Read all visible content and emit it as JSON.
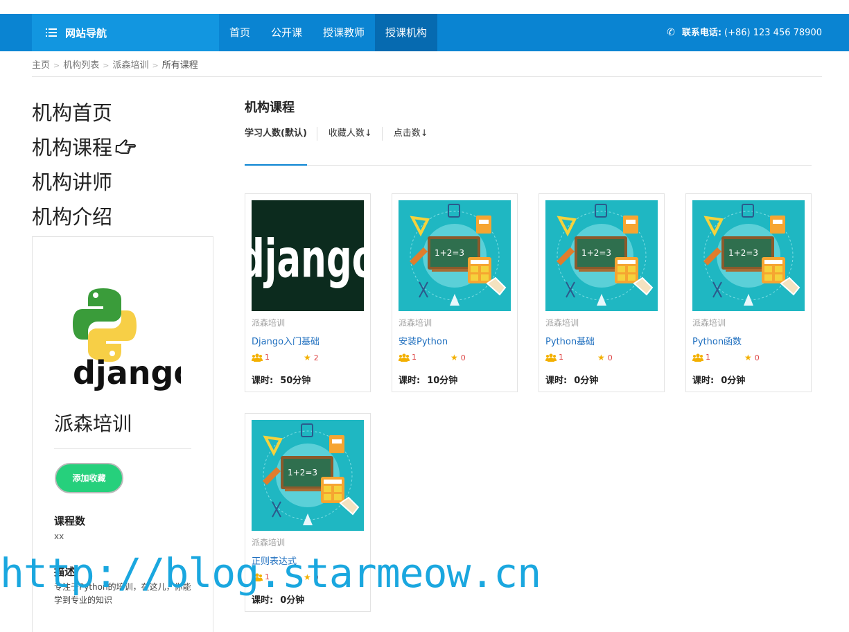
{
  "nav": {
    "brand": "网站导航",
    "links": [
      "首页",
      "公开课",
      "授课教师",
      "授课机构"
    ],
    "active_index": 3,
    "phone_label": "联系电话:",
    "phone_value": "(+86) 123 456 78900"
  },
  "breadcrumb": [
    "主页",
    "机构列表",
    "派森培训",
    "所有课程"
  ],
  "left_menu": [
    "机构首页",
    "机构课程",
    "机构讲师",
    "机构介绍"
  ],
  "active_menu_index": 1,
  "org": {
    "name": "派森培训",
    "fav_button": "添加收藏",
    "course_count_label": "课程数",
    "course_count_value": "xx",
    "desc_label": "描述",
    "desc_value": "专注于Python的培训，在这儿，你能学到专业的知识"
  },
  "main": {
    "title": "机构课程",
    "sort_tabs": [
      "学习人数(默认)",
      "收藏人数↓",
      "点击数↓"
    ]
  },
  "courses": [
    {
      "org": "派森培训",
      "name": "Django入门基础",
      "learners": "1",
      "favs": "2",
      "duration_label": "课时:",
      "duration": "50分钟",
      "thumb": "django-logo"
    },
    {
      "org": "派森培训",
      "name": "安装Python",
      "learners": "1",
      "favs": "0",
      "duration_label": "课时:",
      "duration": "10分钟",
      "thumb": "math-classroom"
    },
    {
      "org": "派森培训",
      "name": "Python基础",
      "learners": "1",
      "favs": "0",
      "duration_label": "课时:",
      "duration": "0分钟",
      "thumb": "math-classroom"
    },
    {
      "org": "派森培训",
      "name": "Python函数",
      "learners": "1",
      "favs": "0",
      "duration_label": "课时:",
      "duration": "0分钟",
      "thumb": "math-classroom"
    },
    {
      "org": "派森培训",
      "name": "正则表达式",
      "learners": "1",
      "favs": "0",
      "duration_label": "课时:",
      "duration": "0分钟",
      "thumb": "math-classroom"
    }
  ],
  "watermark": "http://blog.starmeow.cn",
  "colors": {
    "nav_bg": "#0a84d2",
    "nav_brand_bg": "#1296e0",
    "nav_active": "#066ab0",
    "fav_button": "#26d07c",
    "course_link": "#1f6fbf"
  }
}
